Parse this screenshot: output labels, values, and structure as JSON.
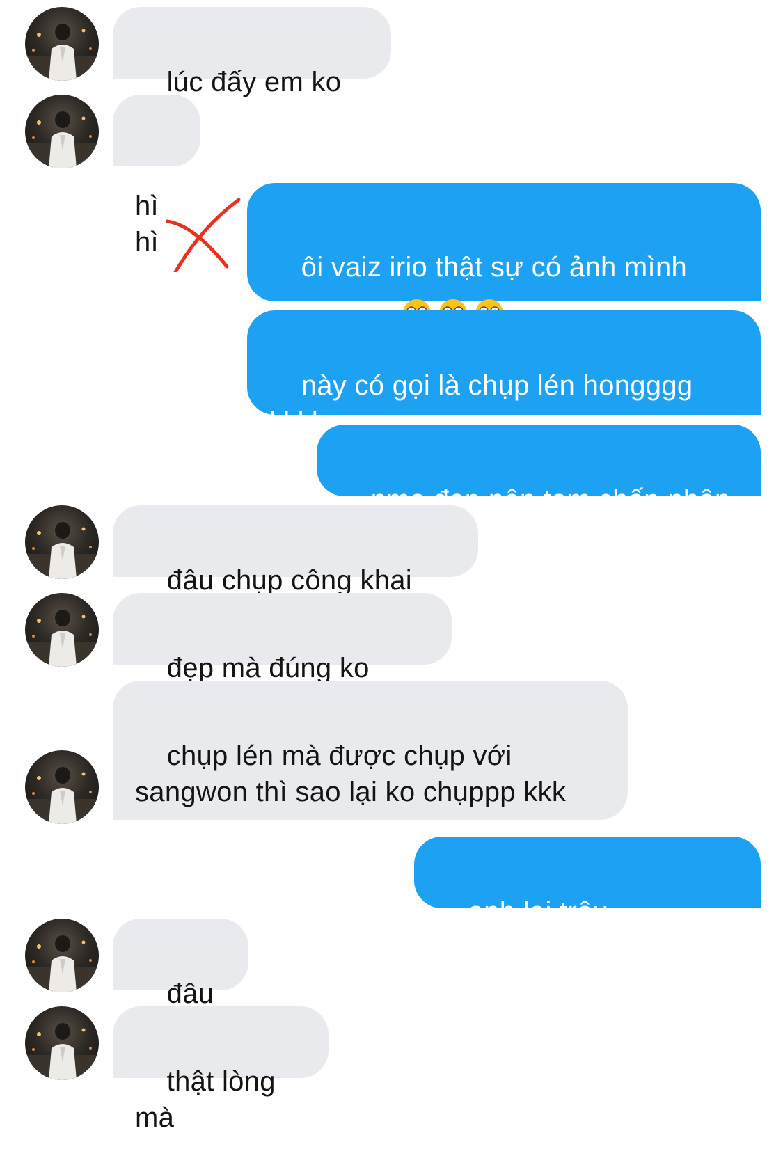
{
  "conversation": {
    "messages": [
      {
        "side": "in",
        "text": "lúc đấy em ko biết"
      },
      {
        "side": "in",
        "text": "hì hì"
      },
      {
        "side": "out",
        "text": "ôi vaiz irio thật sự có ảnh mình trong máy",
        "emoji": [
          "flushed-face",
          "flushed-face",
          "flushed-face"
        ]
      },
      {
        "side": "out",
        "text": "này có gọi là chụp lén hongggg kkkk"
      },
      {
        "side": "out",
        "text": "nma đẹp nên tạm chấp nhận"
      },
      {
        "side": "in",
        "text": "đâu chụp công khai mà"
      },
      {
        "side": "in",
        "text": "đẹp mà đúng ko kkkk"
      },
      {
        "side": "in",
        "text": "chụp lén mà được chụp với sangwon thì sao lại ko chụppp kkk"
      },
      {
        "side": "out",
        "text": "anh lại trêu emmmmm"
      },
      {
        "side": "in",
        "text": "đâu có"
      },
      {
        "side": "in",
        "text": "thật lòng mà"
      }
    ]
  },
  "colors": {
    "incoming_bubble": "#e9eaee",
    "outgoing_bubble": "#1da1f2",
    "annotation_mark": "#e8321e"
  },
  "icons": {
    "annotation": "red-x-mark-icon",
    "avatar": "contact-avatar-photo"
  }
}
